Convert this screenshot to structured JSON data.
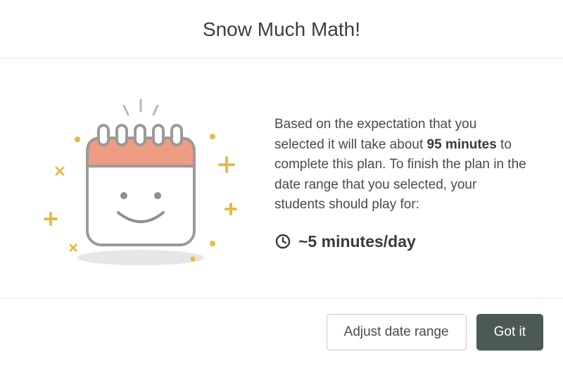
{
  "header": {
    "title": "Snow Much Math!"
  },
  "body": {
    "desc_prefix": "Based on the expectation that you selected it will take about ",
    "total_minutes": "95 minutes",
    "desc_suffix": " to complete this plan. To finish the plan in the date range that you selected, your students should play for:",
    "per_day": "~5 minutes/day"
  },
  "footer": {
    "adjust_label": "Adjust date range",
    "confirm_label": "Got it"
  },
  "illustration": {
    "name": "smiling-calendar"
  },
  "colors": {
    "accent_calendar": "#ee9c83",
    "sparkle": "#e6bb3f",
    "primary_button": "#4b5a56"
  }
}
